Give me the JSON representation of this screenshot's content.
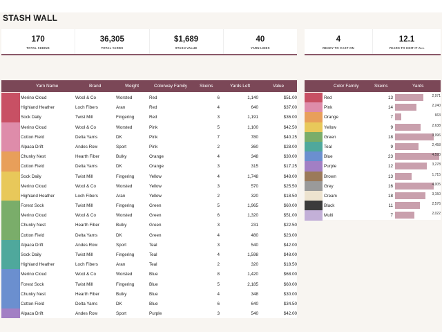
{
  "title": "STASH WALL",
  "kpis_left": [
    {
      "value": "170",
      "label": "TOTAL SKEINS"
    },
    {
      "value": "36,305",
      "label": "TOTAL YARDS"
    },
    {
      "value": "$1,689",
      "label": "STASH VALUE"
    },
    {
      "value": "40",
      "label": "YARN LINES"
    }
  ],
  "kpis_right": [
    {
      "value": "4",
      "label": "READY TO CAST ON"
    },
    {
      "value": "12.1",
      "label": "YEARS TO KNIT IT ALL"
    }
  ],
  "yarn_table": {
    "headers": {
      "name": "Yarn Name",
      "brand": "Brand",
      "weight": "Weight",
      "colorway": "Colorway Family",
      "skeins": "Skeins",
      "yards": "Yards Left",
      "value": "Value"
    },
    "rows": [
      {
        "name": "Merino Cloud",
        "brand": "Wool & Co",
        "weight": "Worsted",
        "colorway": "Red",
        "skeins": "6",
        "yards": "1,140",
        "value": "$51.00",
        "color": "#c85064"
      },
      {
        "name": "Highland Heather",
        "brand": "Loch Fibers",
        "weight": "Aran",
        "colorway": "Red",
        "skeins": "4",
        "yards": "640",
        "value": "$37.00",
        "color": "#c85064"
      },
      {
        "name": "Sock Daily",
        "brand": "Twist Mill",
        "weight": "Fingering",
        "colorway": "Red",
        "skeins": "3",
        "yards": "1,191",
        "value": "$36.00",
        "color": "#c85064"
      },
      {
        "name": "Merino Cloud",
        "brand": "Wool & Co",
        "weight": "Worsted",
        "colorway": "Pink",
        "skeins": "5",
        "yards": "1,100",
        "value": "$42.50",
        "color": "#de8caa"
      },
      {
        "name": "Cotton Field",
        "brand": "Delta Yarns",
        "weight": "DK",
        "colorway": "Pink",
        "skeins": "7",
        "yards": "780",
        "value": "$40.25",
        "color": "#de8caa"
      },
      {
        "name": "Alpaca Drift",
        "brand": "Andes Row",
        "weight": "Sport",
        "colorway": "Pink",
        "skeins": "2",
        "yards": "360",
        "value": "$28.00",
        "color": "#de8caa"
      },
      {
        "name": "Chunky Nest",
        "brand": "Hearth Fiber",
        "weight": "Bulky",
        "colorway": "Orange",
        "skeins": "4",
        "yards": "348",
        "value": "$30.00",
        "color": "#e89f5a"
      },
      {
        "name": "Cotton Field",
        "brand": "Delta Yarns",
        "weight": "DK",
        "colorway": "Orange",
        "skeins": "3",
        "yards": "315",
        "value": "$17.25",
        "color": "#e89f5a"
      },
      {
        "name": "Sock Daily",
        "brand": "Twist Mill",
        "weight": "Fingering",
        "colorway": "Yellow",
        "skeins": "4",
        "yards": "1,748",
        "value": "$48.00",
        "color": "#e8c85a"
      },
      {
        "name": "Merino Cloud",
        "brand": "Wool & Co",
        "weight": "Worsted",
        "colorway": "Yellow",
        "skeins": "3",
        "yards": "570",
        "value": "$25.50",
        "color": "#e8c85a"
      },
      {
        "name": "Highland Heather",
        "brand": "Loch Fibers",
        "weight": "Aran",
        "colorway": "Yellow",
        "skeins": "2",
        "yards": "320",
        "value": "$18.50",
        "color": "#e8c85a"
      },
      {
        "name": "Forest Sock",
        "brand": "Twist Mill",
        "weight": "Fingering",
        "colorway": "Green",
        "skeins": "5",
        "yards": "1,965",
        "value": "$60.00",
        "color": "#7aad6a"
      },
      {
        "name": "Merino Cloud",
        "brand": "Wool & Co",
        "weight": "Worsted",
        "colorway": "Green",
        "skeins": "6",
        "yards": "1,320",
        "value": "$51.00",
        "color": "#7aad6a"
      },
      {
        "name": "Chunky Nest",
        "brand": "Hearth Fiber",
        "weight": "Bulky",
        "colorway": "Green",
        "skeins": "3",
        "yards": "231",
        "value": "$22.50",
        "color": "#7aad6a"
      },
      {
        "name": "Cotton Field",
        "brand": "Delta Yarns",
        "weight": "DK",
        "colorway": "Green",
        "skeins": "4",
        "yards": "480",
        "value": "$23.00",
        "color": "#7aad6a"
      },
      {
        "name": "Alpaca Drift",
        "brand": "Andes Row",
        "weight": "Sport",
        "colorway": "Teal",
        "skeins": "3",
        "yards": "540",
        "value": "$42.00",
        "color": "#4fa89c"
      },
      {
        "name": "Sock Daily",
        "brand": "Twist Mill",
        "weight": "Fingering",
        "colorway": "Teal",
        "skeins": "4",
        "yards": "1,598",
        "value": "$48.00",
        "color": "#4fa89c"
      },
      {
        "name": "Highland Heather",
        "brand": "Loch Fibers",
        "weight": "Aran",
        "colorway": "Teal",
        "skeins": "2",
        "yards": "320",
        "value": "$18.50",
        "color": "#4fa89c"
      },
      {
        "name": "Merino Cloud",
        "brand": "Wool & Co",
        "weight": "Worsted",
        "colorway": "Blue",
        "skeins": "8",
        "yards": "1,420",
        "value": "$68.00",
        "color": "#6b8fcf"
      },
      {
        "name": "Forest Sock",
        "brand": "Twist Mill",
        "weight": "Fingering",
        "colorway": "Blue",
        "skeins": "5",
        "yards": "2,185",
        "value": "$60.00",
        "color": "#6b8fcf"
      },
      {
        "name": "Chunky Nest",
        "brand": "Hearth Fiber",
        "weight": "Bulky",
        "colorway": "Blue",
        "skeins": "4",
        "yards": "348",
        "value": "$30.00",
        "color": "#6b8fcf"
      },
      {
        "name": "Cotton Field",
        "brand": "Delta Yarns",
        "weight": "DK",
        "colorway": "Blue",
        "skeins": "6",
        "yards": "640",
        "value": "$34.50",
        "color": "#6b8fcf"
      },
      {
        "name": "Alpaca Drift",
        "brand": "Andes Row",
        "weight": "Sport",
        "colorway": "Purple",
        "skeins": "3",
        "yards": "540",
        "value": "$42.00",
        "color": "#a27fc4"
      }
    ]
  },
  "family_table": {
    "headers": {
      "family": "Color Family",
      "skeins": "Skeins",
      "yards": "Yards"
    },
    "rows": [
      {
        "family": "Red",
        "skeins": "13",
        "yards": "2,971",
        "yards_num": 2971,
        "color": "#c85064"
      },
      {
        "family": "Pink",
        "skeins": "14",
        "yards": "2,240",
        "yards_num": 2240,
        "color": "#de8caa"
      },
      {
        "family": "Orange",
        "skeins": "7",
        "yards": "663",
        "yards_num": 663,
        "color": "#e89f5a"
      },
      {
        "family": "Yellow",
        "skeins": "9",
        "yards": "2,638",
        "yards_num": 2638,
        "color": "#e8c85a"
      },
      {
        "family": "Green",
        "skeins": "18",
        "yards": "3,996",
        "yards_num": 3996,
        "color": "#7aad6a"
      },
      {
        "family": "Teal",
        "skeins": "9",
        "yards": "2,458",
        "yards_num": 2458,
        "color": "#4fa89c"
      },
      {
        "family": "Blue",
        "skeins": "23",
        "yards": "4,593",
        "yards_num": 4593,
        "color": "#6b8fcf"
      },
      {
        "family": "Purple",
        "skeins": "12",
        "yards": "3,278",
        "yards_num": 3278,
        "color": "#a27fc4"
      },
      {
        "family": "Brown",
        "skeins": "13",
        "yards": "1,715",
        "yards_num": 1715,
        "color": "#9b7a5a"
      },
      {
        "family": "Grey",
        "skeins": "16",
        "yards": "4,005",
        "yards_num": 4005,
        "color": "#9a9a9a"
      },
      {
        "family": "Cream",
        "skeins": "18",
        "yards": "3,150",
        "yards_num": 3150,
        "color": "#ede3cf"
      },
      {
        "family": "Black",
        "skeins": "11",
        "yards": "2,576",
        "yards_num": 2576,
        "color": "#3b3b3b"
      },
      {
        "family": "Multi",
        "skeins": "7",
        "yards": "2,022",
        "yards_num": 2022,
        "color": "#c3b0d8"
      }
    ]
  }
}
